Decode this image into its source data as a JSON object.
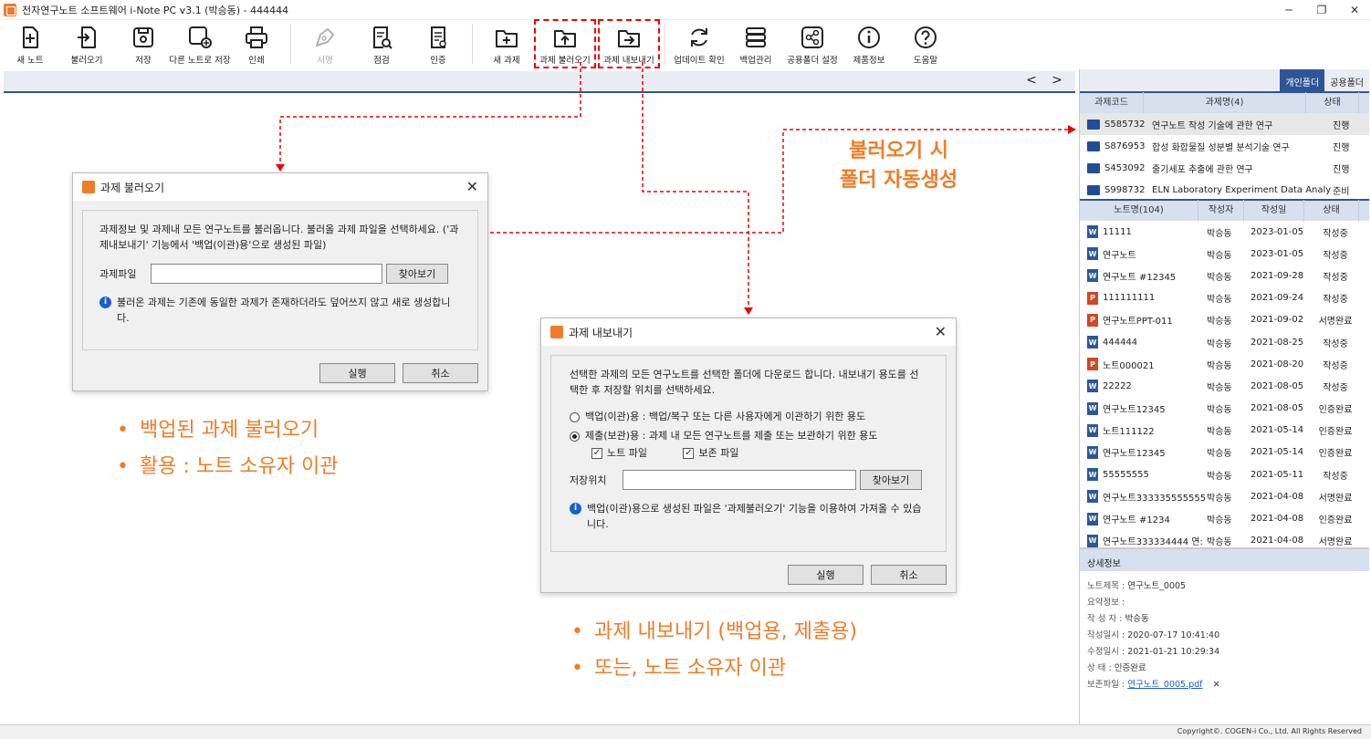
{
  "window": {
    "title": "전자연구노트 소프트웨어 i-Note PC v3.1 (박승동) - 444444",
    "controls": [
      "─",
      "❐",
      "✕"
    ]
  },
  "toolbar": [
    {
      "id": "new-note",
      "label": "새 노트"
    },
    {
      "id": "import",
      "label": "불러오기"
    },
    {
      "id": "save",
      "label": "저장"
    },
    {
      "id": "save-as",
      "label": "다른 노트로 저장"
    },
    {
      "id": "print",
      "label": "인쇄"
    },
    {
      "id": "sign",
      "label": "서명"
    },
    {
      "id": "inspect",
      "label": "점검"
    },
    {
      "id": "certify",
      "label": "인증"
    },
    {
      "id": "new-project",
      "label": "새 과제"
    },
    {
      "id": "project-import",
      "label": "과제 불러오기"
    },
    {
      "id": "project-export",
      "label": "과제 내보내기"
    },
    {
      "id": "update",
      "label": "업데이트 확인"
    },
    {
      "id": "backup",
      "label": "백업관리"
    },
    {
      "id": "shared-folder",
      "label": "공용폴더 설정"
    },
    {
      "id": "product-info",
      "label": "제품정보"
    },
    {
      "id": "help",
      "label": "도움말"
    }
  ],
  "nav": "< >",
  "right_panel": {
    "tabs": [
      "개인폴더",
      "공용폴더"
    ],
    "project_headers": [
      "과제코드",
      "과제명(4)",
      "상태"
    ],
    "projects": [
      {
        "code": "S585732",
        "name": "연구노트 작성 기술에 관한 연구",
        "status": "진행"
      },
      {
        "code": "S876953",
        "name": "합성 화합물질 성분별 분석기술 연구",
        "status": "진행"
      },
      {
        "code": "S453092",
        "name": "줄기세포 추출에 관한 연구",
        "status": "진행"
      },
      {
        "code": "S998732",
        "name": "ELN Laboratory Experiment Data Analy",
        "status": "준비"
      }
    ],
    "note_headers": [
      "노트명(104)",
      "작성자",
      "작성일",
      "상태"
    ],
    "notes": [
      {
        "type": "W",
        "name": "11111",
        "author": "박승동",
        "date": "2023-01-05",
        "status": "작성중"
      },
      {
        "type": "W",
        "name": "연구노트",
        "author": "박승동",
        "date": "2023-01-05",
        "status": "작성중"
      },
      {
        "type": "W",
        "name": "연구노트 #12345",
        "author": "박승동",
        "date": "2021-09-28",
        "status": "작성중"
      },
      {
        "type": "P",
        "name": "111111111",
        "author": "박승동",
        "date": "2021-09-24",
        "status": "작성중"
      },
      {
        "type": "P",
        "name": "연구노트PPT-011",
        "author": "박승동",
        "date": "2021-09-02",
        "status": "서명완료"
      },
      {
        "type": "W",
        "name": "444444",
        "author": "박승동",
        "date": "2021-08-25",
        "status": "작성중"
      },
      {
        "type": "P",
        "name": "노트000021",
        "author": "박승동",
        "date": "2021-08-20",
        "status": "작성중"
      },
      {
        "type": "W",
        "name": "22222",
        "author": "박승동",
        "date": "2021-08-05",
        "status": "작성중"
      },
      {
        "type": "W",
        "name": "연구노트12345",
        "author": "박승동",
        "date": "2021-08-05",
        "status": "인증완료"
      },
      {
        "type": "W",
        "name": "노트111122",
        "author": "박승동",
        "date": "2021-05-14",
        "status": "인증완료"
      },
      {
        "type": "W",
        "name": "연구노트12345",
        "author": "박승동",
        "date": "2021-05-14",
        "status": "인증완료"
      },
      {
        "type": "W",
        "name": "55555555",
        "author": "박승동",
        "date": "2021-05-11",
        "status": "작성중"
      },
      {
        "type": "W",
        "name": "연구노트333335555555",
        "author": "박승동",
        "date": "2021-04-08",
        "status": "서명완료"
      },
      {
        "type": "W",
        "name": "연구노트 #1234",
        "author": "박승동",
        "date": "2021-04-08",
        "status": "인증완료"
      },
      {
        "type": "W",
        "name": "연구노트333334444 연:",
        "author": "박승동",
        "date": "2021-04-08",
        "status": "서명완료"
      }
    ],
    "detail": {
      "header": "상세정보",
      "rows": [
        {
          "k": "노트제목 :",
          "v": "연구노트_0005"
        },
        {
          "k": "요약정보 :",
          "v": ""
        },
        {
          "k": "작 성 자 :",
          "v": "박승동"
        },
        {
          "k": "작성일시 :",
          "v": "2020-07-17 10:41:40"
        },
        {
          "k": "수정일시 :",
          "v": "2021-01-21 10:29:34"
        },
        {
          "k": "상    태 :",
          "v": "인증완료"
        }
      ],
      "attach_label": "보존파일 :",
      "attach_file": "연구노트_0005.pdf",
      "attach_close": "✕"
    }
  },
  "import_dialog": {
    "title": "과제 불러오기",
    "desc": "과제정보 및 과제내 모든 연구노트를 불러옵니다. 불러올 과제 파일을 선택하세요. ('과제내보내기' 기능에서 '백업(이관)용'으로 생성된 파일)",
    "file_label": "과제파일",
    "browse": "찾아보기",
    "info": "불러온 과제는 기존에 동일한 과제가 존재하더라도 덮어쓰지 않고 새로 생성합니다.",
    "ok": "실행",
    "cancel": "취소"
  },
  "export_dialog": {
    "title": "과제 내보내기",
    "desc": "선택한 과제의 모든 연구노트를 선택한 폴더에 다운로드 합니다. 내보내기 용도를 선택한 후 저장할 위치를 선택하세요.",
    "opt1": "백업(이관)용 : 백업/복구 또는 다른 사용자에게 이관하기 위한 용도",
    "opt2": "제출(보관)용 : 과제 내 모든 연구노트를 제출 또는 보관하기 위한 용도",
    "chk1": "노트 파일",
    "chk2": "보존 파일",
    "loc_label": "저장위치",
    "browse": "찾아보기",
    "info": "백업(이관)용으로 생성된 파일은 '과제불러오기' 기능을 이용하여 가져올 수 있습니다.",
    "ok": "실행",
    "cancel": "취소"
  },
  "annotations": {
    "folder_auto": [
      "불러오기 시",
      "폴더 자동생성"
    ],
    "left_bullets": [
      "백업된 과제 불러오기",
      "활용 : 노트 소유자 이관"
    ],
    "right_bullets": [
      "과제 내보내기 (백업용, 제출용)",
      "또는, 노트 소유자 이관"
    ],
    "bullet_char": "•"
  },
  "footer": "Copyright©. COGEN-i Co., Ltd. All Rights Reserved",
  "colors": {
    "accent": "#2e5597",
    "annotation": "#f07c28",
    "highlight": "#e00000"
  }
}
